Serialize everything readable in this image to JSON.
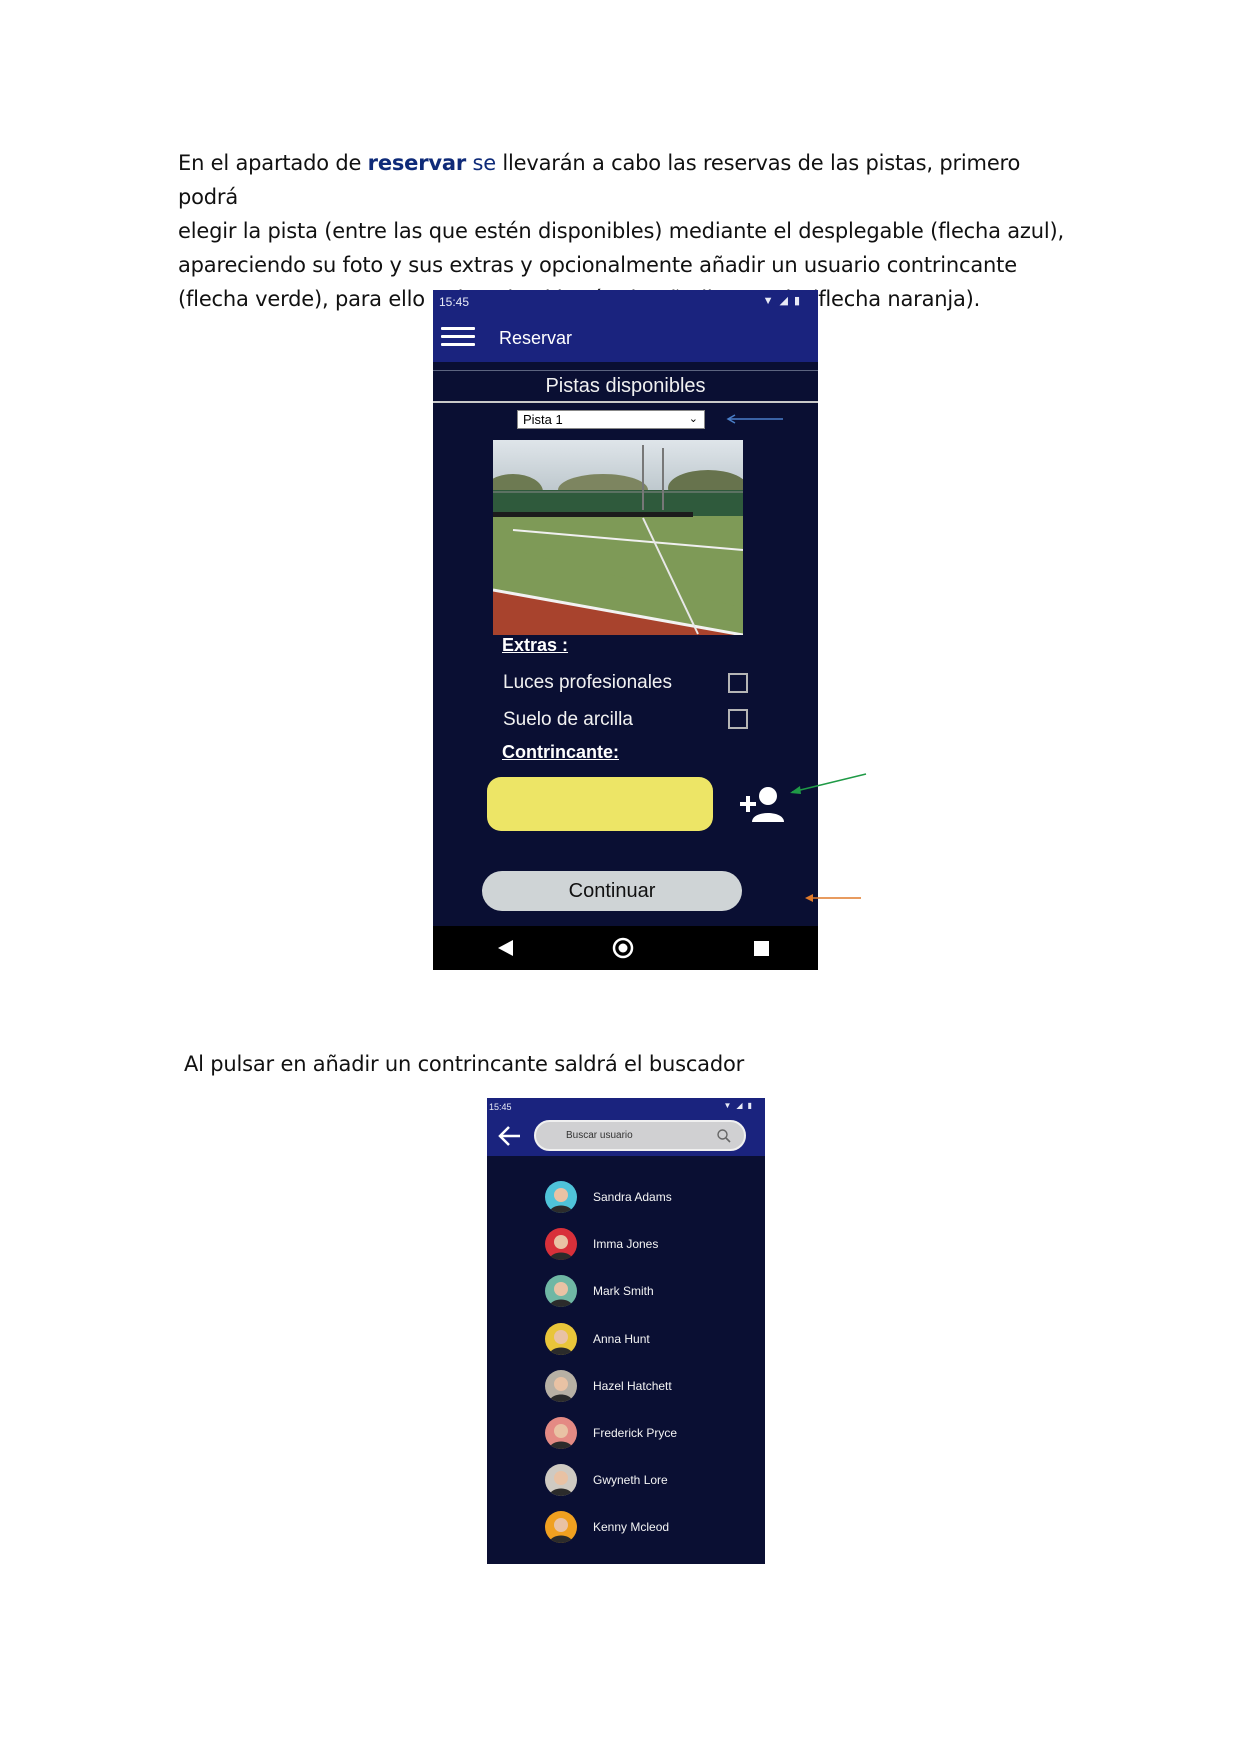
{
  "intro": {
    "line1_pre": "En el apartado de ",
    "line1_bold": "reservar",
    "line1_blue": " se",
    "line1_post": " llevarán a cabo las reservas de las pistas, primero podrá",
    "line2": "elegir la pista (entre las que estén disponibles) mediante el desplegable (flecha azul),",
    "line3": "apareciendo su foto y sus extras y opcionalmente añadir un usuario contrincante",
    "line4": "(flecha verde), para ello pulsando el botón de añadir usuario (flecha naranja)."
  },
  "screen1": {
    "status_time": "15:45",
    "appbar_title": "Reservar",
    "section_title": "Pistas disponibles",
    "selected_court": "Pista 1",
    "extras_title": "Extras :",
    "extras": [
      {
        "label": "Luces profesionales",
        "checked": false
      },
      {
        "label": "Suelo de arcilla",
        "checked": false
      }
    ],
    "rival_title": "Contrincante:",
    "continue_label": "Continuar"
  },
  "arrows": {
    "blue": "#4a7fc9",
    "green": "#1f9a46",
    "orange": "#e07a2a"
  },
  "caption2": "Al pulsar en añadir un contrincante saldrá el buscador",
  "screen2": {
    "status_time": "15:45",
    "search_placeholder": "Buscar usuario",
    "users": [
      {
        "name": "Sandra Adams",
        "color": "#4fc3d9"
      },
      {
        "name": "Imma Jones",
        "color": "#d8303a"
      },
      {
        "name": "Mark Smith",
        "color": "#6fb7a4"
      },
      {
        "name": "Anna Hunt",
        "color": "#e9c53a"
      },
      {
        "name": "Hazel Hatchett",
        "color": "#b7b0a4"
      },
      {
        "name": "Frederick Pryce",
        "color": "#e48a84"
      },
      {
        "name": "Gwyneth Lore",
        "color": "#cfcac2"
      },
      {
        "name": "Kenny Mcleod",
        "color": "#f0a020"
      }
    ]
  }
}
